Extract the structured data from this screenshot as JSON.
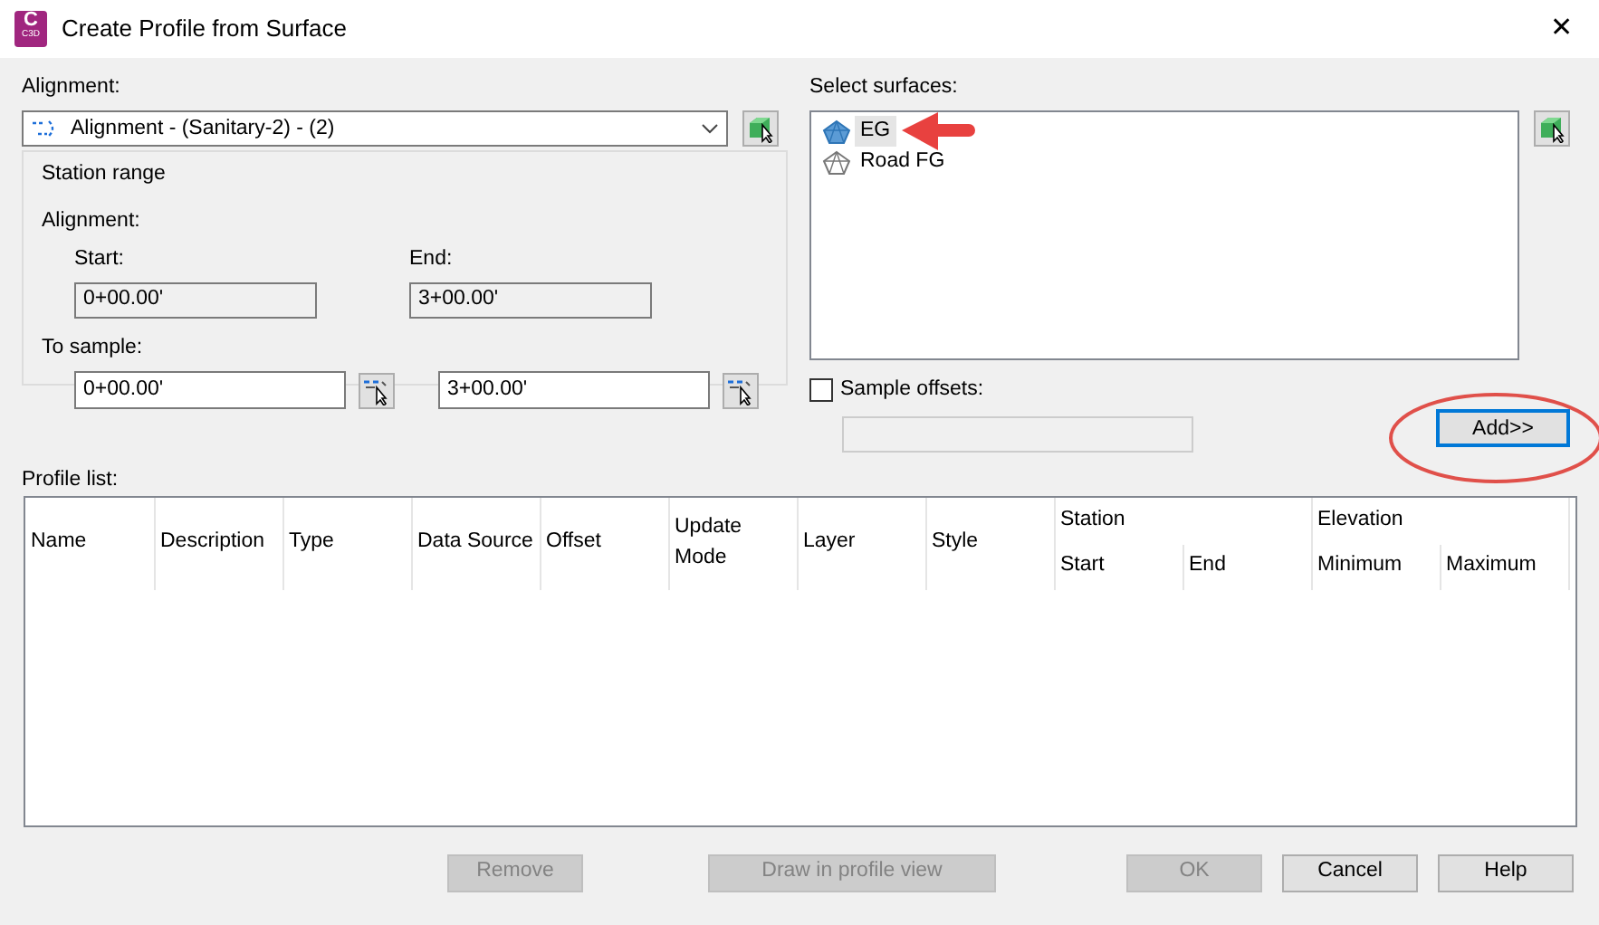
{
  "window": {
    "title": "Create Profile from Surface",
    "app_icon_letter": "C",
    "app_icon_sub": "C3D",
    "close": "✕"
  },
  "alignment": {
    "label": "Alignment:",
    "value": "Alignment - (Sanitary-2) - (2)"
  },
  "station_range": {
    "title": "Station range",
    "alignment_label": "Alignment:",
    "start_label": "Start:",
    "start_value": "0+00.00'",
    "end_label": "End:",
    "end_value": "3+00.00'",
    "to_sample_label": "To sample:",
    "sample_start": "0+00.00'",
    "sample_end": "3+00.00'"
  },
  "surfaces": {
    "label": "Select surfaces:",
    "items": [
      {
        "name": "EG",
        "selected": true
      },
      {
        "name": "Road FG",
        "selected": false
      }
    ]
  },
  "sample_offsets": {
    "label": "Sample offsets:",
    "checked": false
  },
  "add_button": {
    "label": "Add>>",
    "focused": true
  },
  "profile_list": {
    "label": "Profile list:",
    "columns": [
      {
        "label": "Name"
      },
      {
        "label": "Description"
      },
      {
        "label": "Type"
      },
      {
        "label": "Data Source"
      },
      {
        "label": "Offset"
      },
      {
        "label": "Update Mode"
      },
      {
        "label": "Layer"
      },
      {
        "label": "Style"
      },
      {
        "label": "Station",
        "children": [
          {
            "label": "Start"
          },
          {
            "label": "End"
          }
        ]
      },
      {
        "label": "Elevation",
        "children": [
          {
            "label": "Minimum"
          },
          {
            "label": "Maximum"
          }
        ]
      }
    ]
  },
  "buttons": [
    {
      "label": "Remove",
      "disabled": true
    },
    {
      "label": "Draw in profile view",
      "disabled": true
    },
    {
      "label": "OK",
      "disabled": true
    },
    {
      "label": "Cancel",
      "disabled": false
    },
    {
      "label": "Help",
      "disabled": false
    }
  ]
}
